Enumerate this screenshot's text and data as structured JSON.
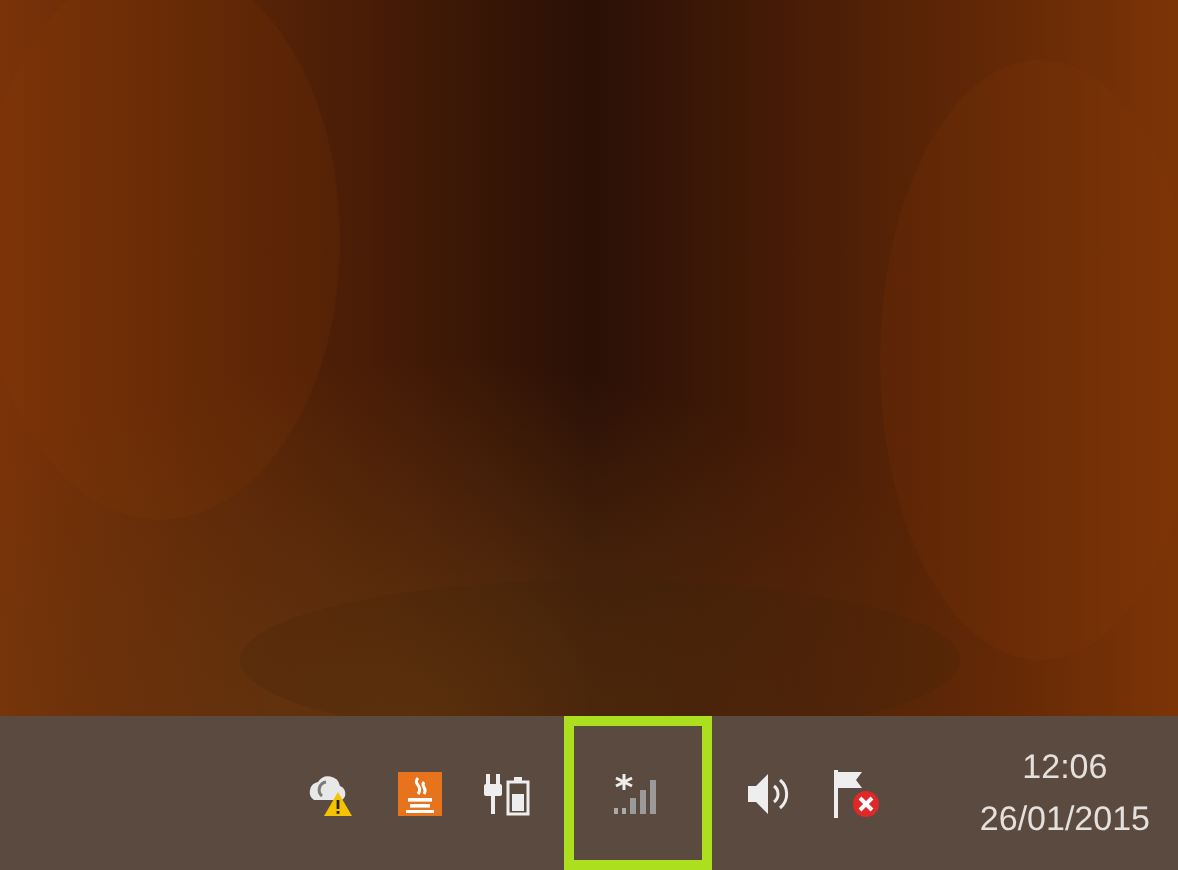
{
  "taskbar": {
    "tray_icons": [
      {
        "kind": "cloud-warning",
        "highlighted": false
      },
      {
        "kind": "java",
        "highlighted": false
      },
      {
        "kind": "power",
        "highlighted": false
      },
      {
        "kind": "signal",
        "highlighted": true
      },
      {
        "kind": "volume",
        "highlighted": false
      },
      {
        "kind": "flag",
        "highlighted": false
      }
    ],
    "clock": {
      "time": "12:06",
      "date": "26/01/2015"
    }
  }
}
